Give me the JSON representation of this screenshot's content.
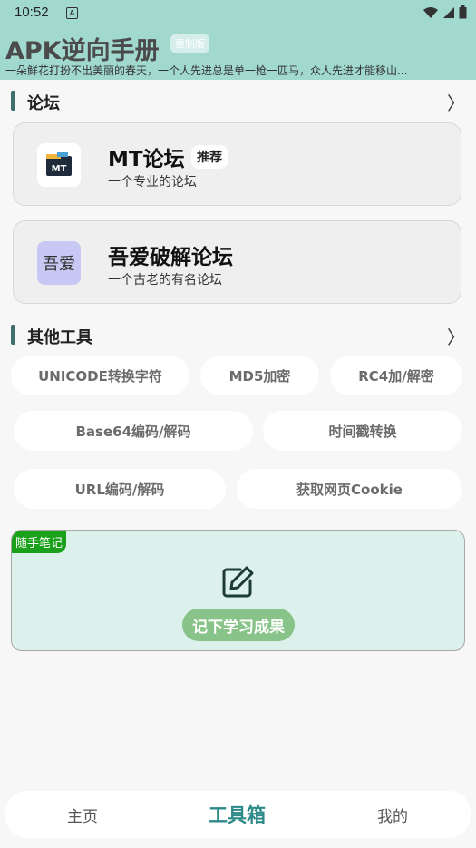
{
  "status": {
    "time": "10:52",
    "a_icon": "A"
  },
  "header": {
    "title": "APK逆向手册",
    "badge": "重制版",
    "marquee": "一朵鲜花打扮不出美丽的春天，一个人先进总是单一枪一匹马，众人先进才能移山..."
  },
  "forum": {
    "section_title": "论坛",
    "chevron": "〉",
    "cards": [
      {
        "name": "MT论坛",
        "tag": "推荐",
        "desc": "一个专业的论坛",
        "logo": "MT"
      },
      {
        "name": "吾爱破解论坛",
        "desc": "一个古老的有名论坛",
        "logo": "吾爱"
      }
    ]
  },
  "tools": {
    "section_title": "其他工具",
    "chevron": "〉",
    "chips": [
      "UNICODE转换字符",
      "MD5加密",
      "RC4加/解密",
      "Base64编码/解码",
      "时间戳转换",
      "URL编码/解码",
      "获取网页Cookie"
    ]
  },
  "note": {
    "tag": "随手笔记",
    "button": "记下学习成果",
    "icon": "edit-icon"
  },
  "nav": {
    "home": "主页",
    "tools": "工具箱",
    "mine": "我的",
    "active": "tools"
  },
  "colors": {
    "header_bg": "#a2d9cf",
    "accent": "#2e8a88",
    "note_bg": "#dcf0ec",
    "note_tag": "#1aa01a",
    "note_button": "#88c489"
  }
}
